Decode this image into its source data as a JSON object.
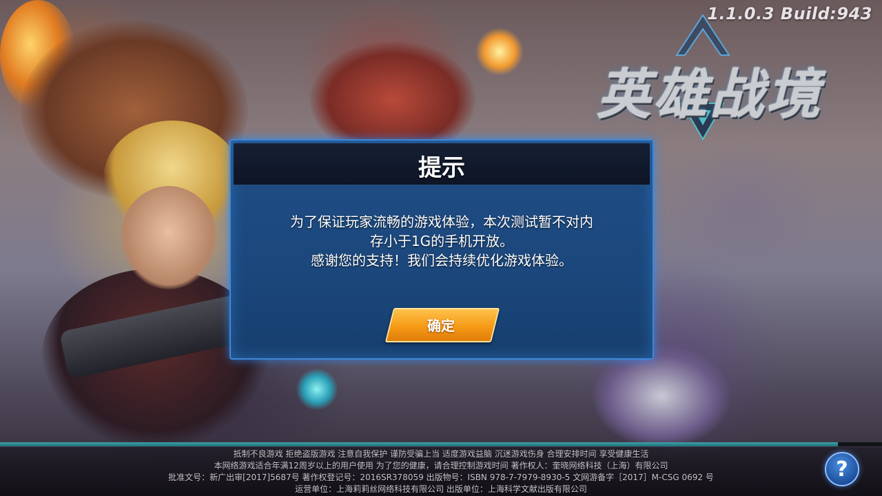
{
  "version": "1.1.0.3 Build:943",
  "logo": {
    "text": "英雄战境"
  },
  "dialog": {
    "title": "提示",
    "message_lines": [
      "为了保证玩家流畅的游戏体验，本次测试暂不对内",
      "存小于1G的手机开放。",
      "感谢您的支持！我们会持续优化游戏体验。"
    ],
    "ok_label": "确定"
  },
  "loading": {
    "progress_fraction": 0.95
  },
  "footer": {
    "lines": [
      "抵制不良游戏  拒绝盗版游戏  注意自我保护  谨防受骗上当  适度游戏益脑  沉迷游戏伤身  合理安排时间  享受健康生活",
      "本网络游戏适合年满12周岁以上的用户使用 为了您的健康，请合理控制游戏时间 著作权人：奎晓网络科技（上海）有限公司",
      "批准文号：新广出审[2017]5687号  著作权登记号：2016SR378059 出版物号：ISBN 978-7-7979-8930-5  文网游备字［2017］M-CSG 0692 号",
      "运营单位：上海莉莉丝网络科技有限公司  出版单位：上海科学文献出版有限公司"
    ]
  },
  "help": {
    "icon": "question-icon",
    "glyph": "?"
  },
  "colors": {
    "dialog_bg": "#1f4e86",
    "dialog_border": "#3f87d6",
    "button_orange": "#f59a16",
    "progress_teal": "#3fa2a8"
  }
}
